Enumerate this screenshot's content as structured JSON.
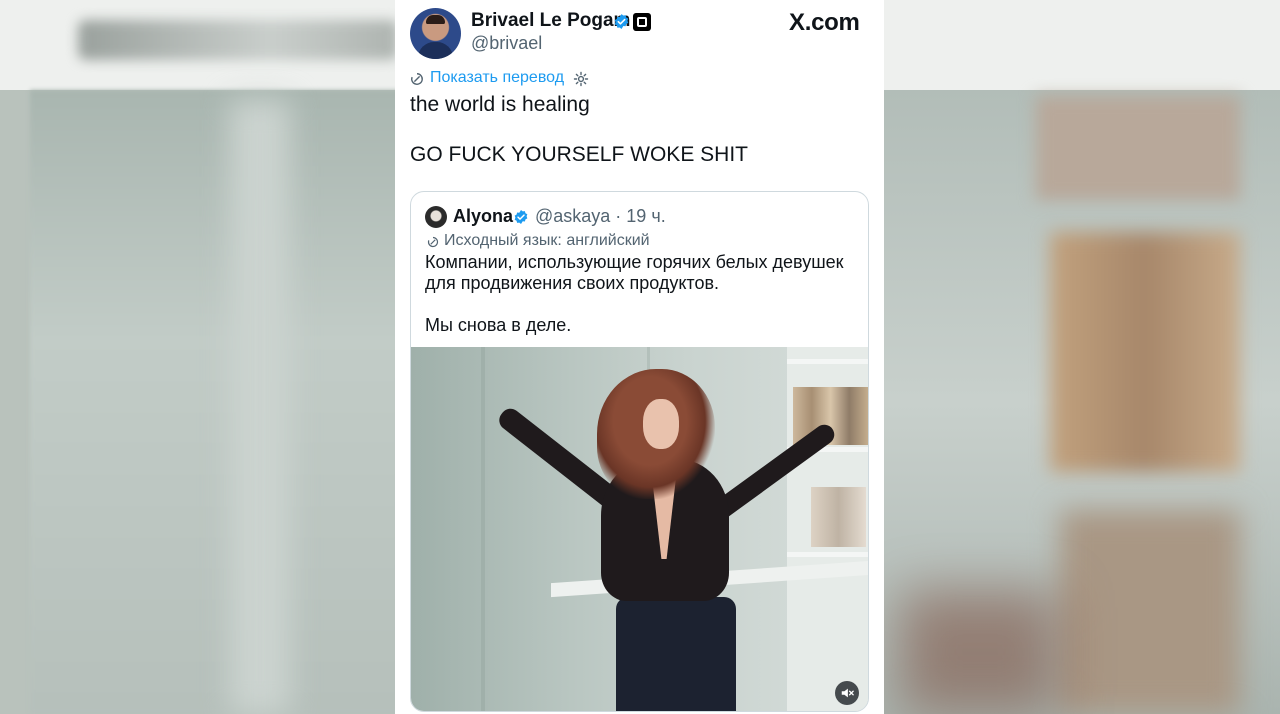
{
  "tweet": {
    "author": {
      "name": "Brivael Le Pogam",
      "handle": "@brivael",
      "avatar_icon": "author-avatar",
      "verified_icon": "verified-badge-icon",
      "affiliate_icon": "affiliate-badge-icon"
    },
    "brand": "X.com",
    "translate": {
      "label": "Показать перевод",
      "icon": "translate-icon",
      "settings_icon": "gear-icon"
    },
    "text": {
      "line1": "the world is healing",
      "line2": "GO FUCK YOURSELF WOKE SHIT"
    },
    "quote": {
      "author_name": "Alyona",
      "handle_time": "@askaya · 19 ч.",
      "source_language": "Исходный язык: английский",
      "paragraph1": "Компании, использующие горячих белых девушек для продвижения своих продуктов.",
      "paragraph2": "Мы снова в деле.",
      "media": {
        "type": "video",
        "mute_icon": "muted-speaker-icon"
      }
    }
  },
  "colors": {
    "link": "#1d9bf0",
    "verified": "#1d9bf0",
    "text_primary": "#0f1419",
    "text_secondary": "#536471",
    "border": "#cfd9de"
  }
}
